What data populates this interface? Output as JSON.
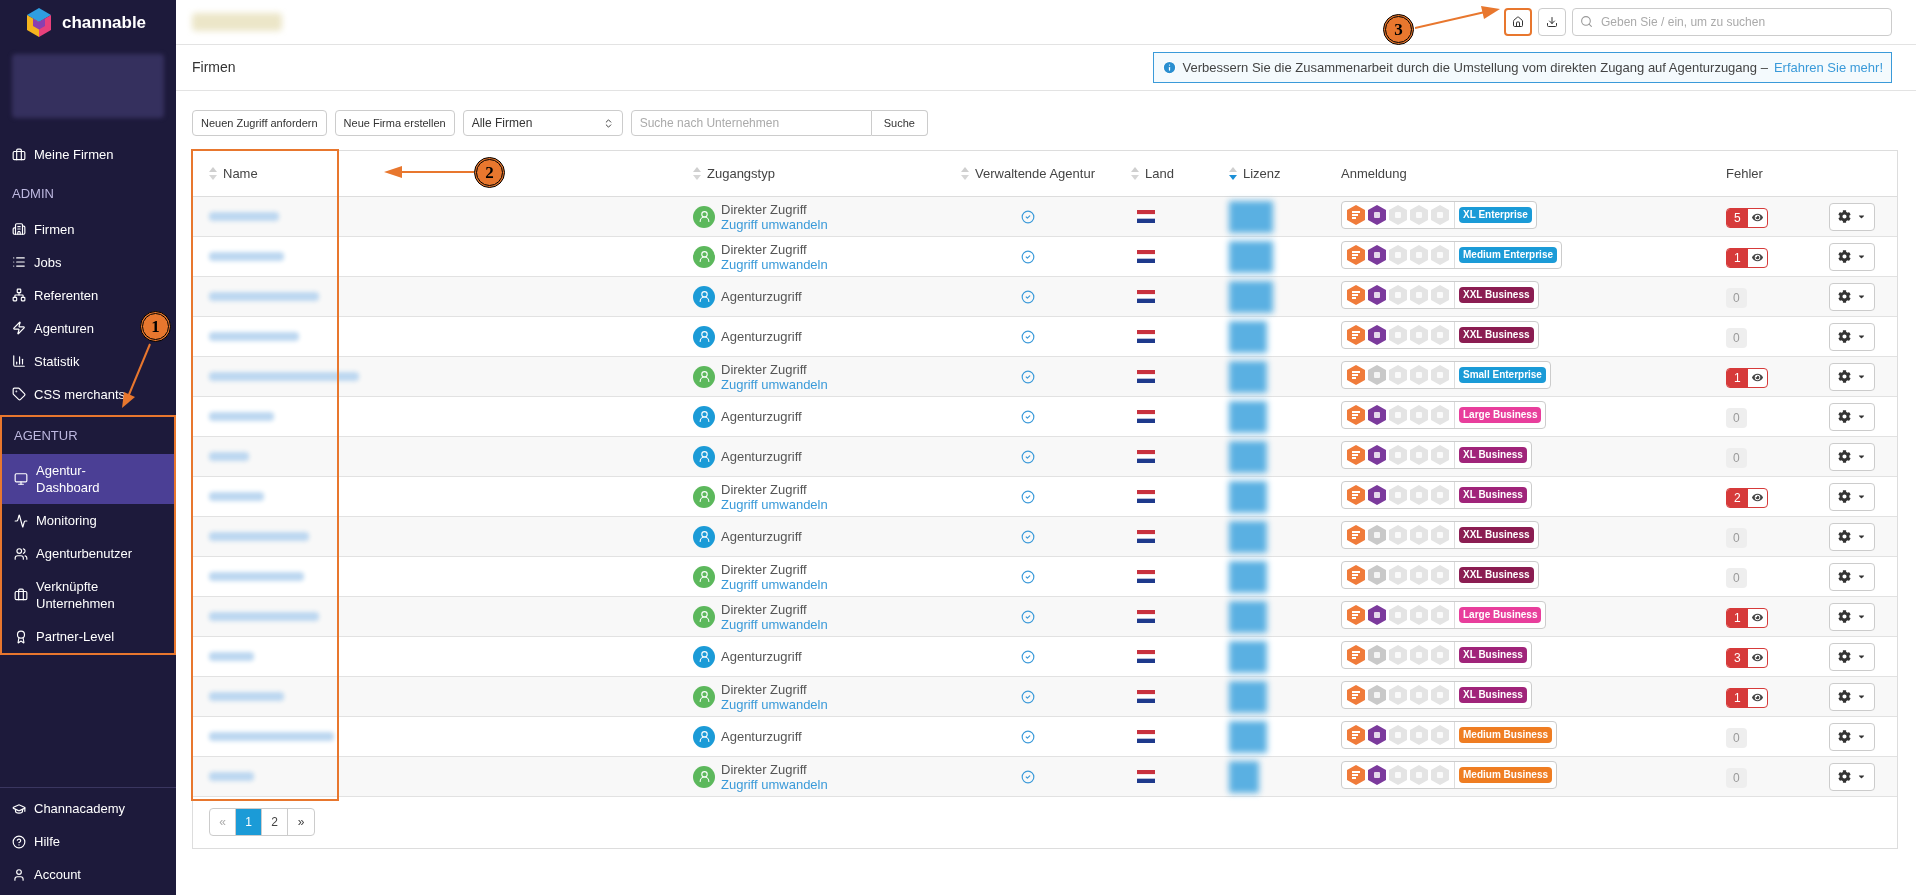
{
  "sidebar": {
    "brand": "channable",
    "top_items": [
      {
        "label": "Meine Firmen",
        "selected": false
      }
    ],
    "sections": [
      {
        "title": "ADMIN",
        "highlighted": false,
        "items": [
          {
            "label": "Firmen",
            "selected": false
          },
          {
            "label": "Jobs",
            "selected": false
          },
          {
            "label": "Referenten",
            "selected": false
          },
          {
            "label": "Agenturen",
            "selected": false
          },
          {
            "label": "Statistik",
            "selected": false
          },
          {
            "label": "CSS merchants",
            "selected": false
          }
        ]
      },
      {
        "title": "AGENTUR",
        "highlighted": true,
        "items": [
          {
            "label": "Agentur-Dashboard",
            "selected": true
          },
          {
            "label": "Monitoring",
            "selected": false
          },
          {
            "label": "Agenturbenutzer",
            "selected": false
          },
          {
            "label": "Verknüpfte Unternehmen",
            "selected": false
          },
          {
            "label": "Partner-Level",
            "selected": false
          }
        ]
      }
    ],
    "bottom_items": [
      {
        "label": "Channacademy",
        "selected": false
      },
      {
        "label": "Hilfe",
        "selected": false
      },
      {
        "label": "Account",
        "selected": false
      }
    ]
  },
  "topbar": {
    "home_highlighted": true,
    "search": {
      "placeholder": "Geben Sie / ein, um zu suchen"
    }
  },
  "page": {
    "title": "Firmen",
    "notice": {
      "text": "Verbessern Sie die Zusammenarbeit durch die Umstellung vom direkten Zugang auf Agenturzugang –",
      "link": "Erfahren Sie mehr!"
    }
  },
  "toolbar": {
    "buttons": [
      "Neuen Zugriff anfordern",
      "Neue Firma erstellen"
    ],
    "filter": {
      "value": "Alle Firmen"
    },
    "search": {
      "placeholder": "Suche nach Unternehmen"
    },
    "search_button": "Suche"
  },
  "table": {
    "name_column_highlighted": true,
    "columns": [
      {
        "kind": "sortable",
        "label": "Name",
        "sorted": false
      },
      {
        "kind": "sortable",
        "label": "Zugangstyp",
        "sorted": false
      },
      {
        "kind": "sortable",
        "label": "Verwaltende Agentur",
        "sorted": false
      },
      {
        "kind": "sortable",
        "label": "Land",
        "sorted": false
      },
      {
        "kind": "sortable",
        "label": "Lizenz",
        "sorted": true
      },
      {
        "kind": "plain",
        "label": "Anmeldung"
      },
      {
        "kind": "plain",
        "label": "Fehler"
      }
    ],
    "rows": [
      {
        "access": {
          "kind": "direct",
          "label": "Direkter Zugriff",
          "link": "Zugriff umwandeln"
        },
        "managed": true,
        "modules": [
          true,
          true,
          false,
          false,
          false
        ],
        "plan": {
          "label": "XL Enterprise",
          "color": "#1b9bd7"
        },
        "errors": {
          "count": "5",
          "flagged": true
        }
      },
      {
        "access": {
          "kind": "direct",
          "label": "Direkter Zugriff",
          "link": "Zugriff umwandeln"
        },
        "managed": true,
        "modules": [
          true,
          true,
          false,
          false,
          false
        ],
        "plan": {
          "label": "Medium Enterprise",
          "color": "#1b9bd7"
        },
        "errors": {
          "count": "1",
          "flagged": true
        }
      },
      {
        "access": {
          "kind": "agency",
          "label": "Agenturzugriff"
        },
        "managed": true,
        "modules": [
          true,
          true,
          false,
          false,
          false
        ],
        "plan": {
          "label": "XXL Business",
          "color": "#8b1d52"
        },
        "errors": {
          "count": "0",
          "flagged": false
        }
      },
      {
        "access": {
          "kind": "agency",
          "label": "Agenturzugriff"
        },
        "managed": true,
        "modules": [
          true,
          true,
          false,
          false,
          false
        ],
        "plan": {
          "label": "XXL Business",
          "color": "#8b1d52"
        },
        "errors": {
          "count": "0",
          "flagged": false
        }
      },
      {
        "access": {
          "kind": "direct",
          "label": "Direkter Zugriff",
          "link": "Zugriff umwandeln"
        },
        "managed": true,
        "modules": [
          true,
          false,
          false,
          false,
          false
        ],
        "plan": {
          "label": "Small Enterprise",
          "color": "#1b9bd7"
        },
        "errors": {
          "count": "1",
          "flagged": true
        }
      },
      {
        "access": {
          "kind": "agency",
          "label": "Agenturzugriff"
        },
        "managed": true,
        "modules": [
          true,
          true,
          false,
          false,
          false
        ],
        "plan": {
          "label": "Large Business",
          "color": "#e83e9c"
        },
        "errors": {
          "count": "0",
          "flagged": false
        }
      },
      {
        "access": {
          "kind": "agency",
          "label": "Agenturzugriff"
        },
        "managed": true,
        "modules": [
          true,
          true,
          false,
          false,
          false
        ],
        "plan": {
          "label": "XL Business",
          "color": "#a0247a"
        },
        "errors": {
          "count": "0",
          "flagged": false
        }
      },
      {
        "access": {
          "kind": "direct",
          "label": "Direkter Zugriff",
          "link": "Zugriff umwandeln"
        },
        "managed": true,
        "modules": [
          true,
          true,
          false,
          false,
          false
        ],
        "plan": {
          "label": "XL Business",
          "color": "#a0247a"
        },
        "errors": {
          "count": "2",
          "flagged": true
        }
      },
      {
        "access": {
          "kind": "agency",
          "label": "Agenturzugriff"
        },
        "managed": true,
        "modules": [
          true,
          false,
          false,
          false,
          false
        ],
        "plan": {
          "label": "XXL Business",
          "color": "#8b1d52"
        },
        "errors": {
          "count": "0",
          "flagged": false
        }
      },
      {
        "access": {
          "kind": "direct",
          "label": "Direkter Zugriff",
          "link": "Zugriff umwandeln"
        },
        "managed": true,
        "modules": [
          true,
          false,
          false,
          false,
          false
        ],
        "plan": {
          "label": "XXL Business",
          "color": "#8b1d52"
        },
        "errors": {
          "count": "0",
          "flagged": false
        }
      },
      {
        "access": {
          "kind": "direct",
          "label": "Direkter Zugriff",
          "link": "Zugriff umwandeln"
        },
        "managed": true,
        "modules": [
          true,
          true,
          false,
          false,
          false
        ],
        "plan": {
          "label": "Large Business",
          "color": "#e83e9c"
        },
        "errors": {
          "count": "1",
          "flagged": true
        }
      },
      {
        "access": {
          "kind": "agency",
          "label": "Agenturzugriff"
        },
        "managed": true,
        "modules": [
          true,
          false,
          false,
          false,
          false
        ],
        "plan": {
          "label": "XL Business",
          "color": "#a0247a"
        },
        "errors": {
          "count": "3",
          "flagged": true
        }
      },
      {
        "access": {
          "kind": "direct",
          "label": "Direkter Zugriff",
          "link": "Zugriff umwandeln"
        },
        "managed": true,
        "modules": [
          true,
          false,
          false,
          false,
          false
        ],
        "plan": {
          "label": "XL Business",
          "color": "#a0247a"
        },
        "errors": {
          "count": "1",
          "flagged": true
        }
      },
      {
        "access": {
          "kind": "agency",
          "label": "Agenturzugriff"
        },
        "managed": true,
        "modules": [
          true,
          true,
          false,
          false,
          false
        ],
        "plan": {
          "label": "Medium Business",
          "color": "#ef7d22"
        },
        "errors": {
          "count": "0",
          "flagged": false
        }
      },
      {
        "access": {
          "kind": "direct",
          "label": "Direkter Zugriff",
          "link": "Zugriff umwandeln"
        },
        "managed": true,
        "modules": [
          true,
          true,
          false,
          false,
          false
        ],
        "plan": {
          "label": "Medium Business",
          "color": "#ef7d22"
        },
        "errors": {
          "count": "0",
          "flagged": false
        }
      }
    ]
  },
  "pagination": {
    "prev": "«",
    "pages": [
      {
        "label": "1",
        "selected": true
      },
      {
        "label": "2",
        "selected": false
      }
    ],
    "next": "»"
  },
  "annotations": [
    {
      "label": "1"
    },
    {
      "label": "2"
    },
    {
      "label": "3"
    }
  ]
}
